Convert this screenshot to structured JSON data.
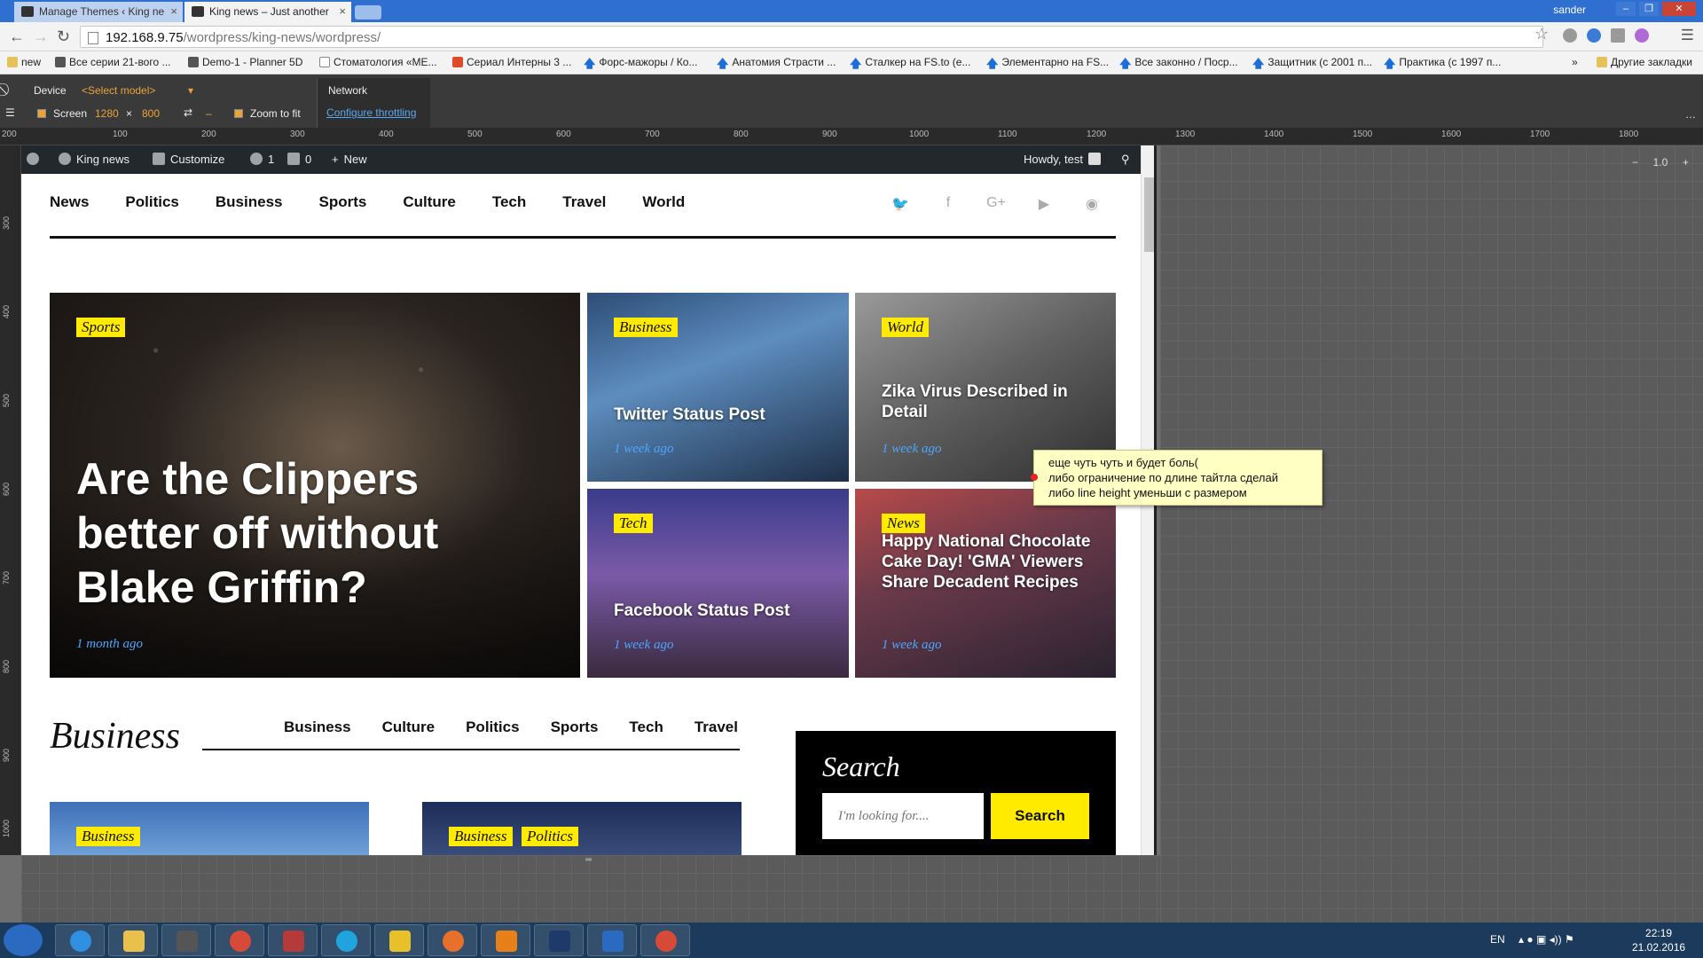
{
  "browser": {
    "tabs": [
      {
        "label": "Manage Themes ‹ King ne"
      },
      {
        "label": "King news – Just another"
      }
    ],
    "user": "sander",
    "url_host": "192.168.9.75",
    "url_path": "/wordpress/king-news/wordpress/",
    "bookmarks": [
      "new",
      "Все серии 21-вого ...",
      "Demo-1 - Planner 5D",
      "Стоматология «МЕ...",
      "Сериал Интерны 3 ...",
      "Форс-мажоры / Ко...",
      "Анатомия Страсти ...",
      "Сталкер на FS.to (е...",
      "Элементарно на FS...",
      "Все законно / Поср...",
      "Защитник (с 2001 п...",
      "Практика (с 1997 п...",
      "»",
      "Другие закладки"
    ]
  },
  "devtools": {
    "device_label": "Device",
    "model_select": "<Select model>",
    "screen_label": "Screen",
    "width": "1280",
    "times": "×",
    "height": "800",
    "dash": "–",
    "zoom_to_fit": "Zoom to fit",
    "network_label": "Network",
    "throttling_link": "Configure throttling",
    "zoom_minus": "−",
    "zoom_value": "1.0",
    "zoom_plus": "+",
    "ruler_top": [
      "200",
      "100",
      "200",
      "300",
      "400",
      "500",
      "600",
      "700",
      "800",
      "900",
      "1000",
      "1100",
      "1200",
      "1300",
      "1400",
      "1500",
      "1600",
      "1700",
      "1800"
    ],
    "ruler_left": [
      "300",
      "400",
      "500",
      "600",
      "700",
      "800",
      "900",
      "1000"
    ]
  },
  "adminbar": {
    "site": "King news",
    "customize": "Customize",
    "updates": "1",
    "comments": "0",
    "new": "New",
    "howdy": "Howdy, test"
  },
  "site": {
    "nav": [
      "News",
      "Politics",
      "Business",
      "Sports",
      "Culture",
      "Tech",
      "Travel",
      "World"
    ],
    "social_icons": [
      "twitter-icon",
      "facebook-icon",
      "google-plus-icon",
      "youtube-icon",
      "rss-icon"
    ],
    "social_glyphs": [
      "🐦",
      "f",
      "G+",
      "▶",
      "◉"
    ],
    "featured": [
      {
        "badge": "Sports",
        "title": "Are the Clippers better off without Blake Griffin?",
        "time": "1 month ago"
      },
      {
        "badge": "Business",
        "title": "Twitter Status Post",
        "time": "1 week ago"
      },
      {
        "badge": "World",
        "title": "Zika Virus Described in Detail",
        "time": "1 week ago"
      },
      {
        "badge": "Tech",
        "title": "Facebook Status Post",
        "time": "1 week ago"
      },
      {
        "badge": "News",
        "title": "Happy National Chocolate Cake Day! 'GMA' Viewers Share Decadent Recipes",
        "time": "1 week ago"
      }
    ],
    "section_title": "Business",
    "section_tabs": [
      "Business",
      "Culture",
      "Politics",
      "Sports",
      "Tech",
      "Travel"
    ],
    "bottom_cards": [
      {
        "badges": [
          "Business"
        ]
      },
      {
        "badges": [
          "Business",
          "Politics"
        ]
      }
    ],
    "search_widget": {
      "title": "Search",
      "placeholder": "I'm looking for....",
      "button": "Search"
    }
  },
  "tooltip": {
    "lines": [
      "еще чуть чуть и будет боль(",
      "либо ограничение по длине тайтла сделай",
      "либо line height уменьши с размером"
    ]
  },
  "taskbar": {
    "lang": "EN",
    "time": "22:19",
    "date": "21.02.2016"
  }
}
